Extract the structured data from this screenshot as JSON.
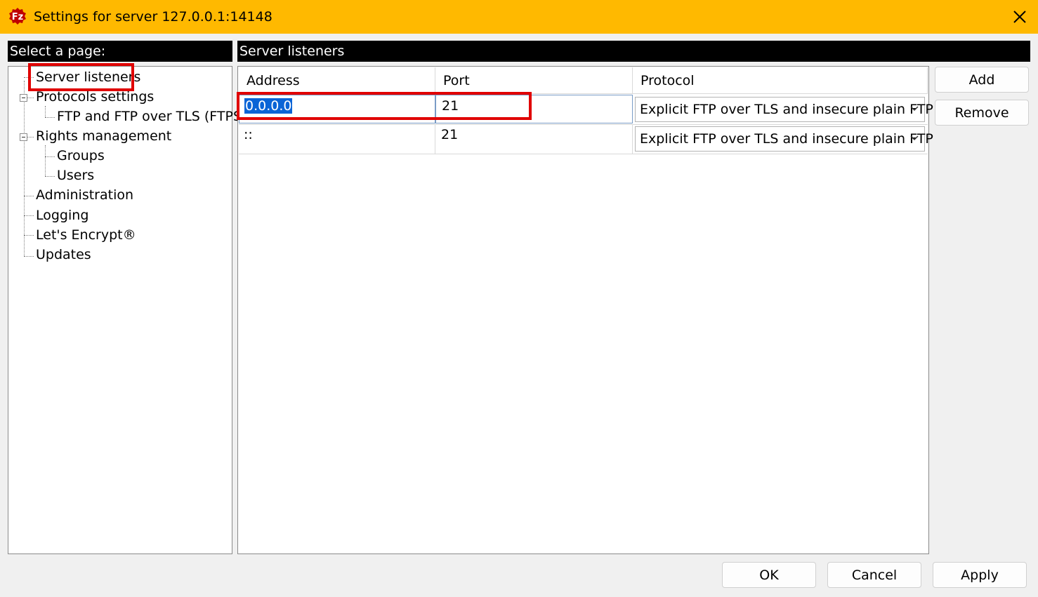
{
  "window": {
    "title": "Settings for server 127.0.0.1:14148",
    "close_glyph": "✕",
    "accent_color": "#ffb900"
  },
  "left_pane": {
    "header": "Select a page:",
    "tree": [
      {
        "label": "Server listeners",
        "level": 0,
        "selected": true
      },
      {
        "label": "Protocols settings",
        "level": 0,
        "expanded": true
      },
      {
        "label": "FTP and FTP over TLS (FTPS)",
        "level": 1
      },
      {
        "label": "Rights management",
        "level": 0,
        "expanded": true
      },
      {
        "label": "Groups",
        "level": 1
      },
      {
        "label": "Users",
        "level": 1
      },
      {
        "label": "Administration",
        "level": 0
      },
      {
        "label": "Logging",
        "level": 0
      },
      {
        "label": "Let's Encrypt®",
        "level": 0
      },
      {
        "label": "Updates",
        "level": 0
      }
    ]
  },
  "right_pane": {
    "header": "Server listeners",
    "columns": [
      "Address",
      "Port",
      "Protocol"
    ],
    "rows": [
      {
        "address": "0.0.0.0",
        "port": "21",
        "protocol": "Explicit FTP over TLS and insecure plain FTP"
      },
      {
        "address": "::",
        "port": "21",
        "protocol": "Explicit FTP over TLS and insecure plain FTP"
      }
    ],
    "add_label": "Add",
    "remove_label": "Remove"
  },
  "footer": {
    "ok_label": "OK",
    "cancel_label": "Cancel",
    "apply_label": "Apply"
  },
  "annotation_color": "#e00000"
}
